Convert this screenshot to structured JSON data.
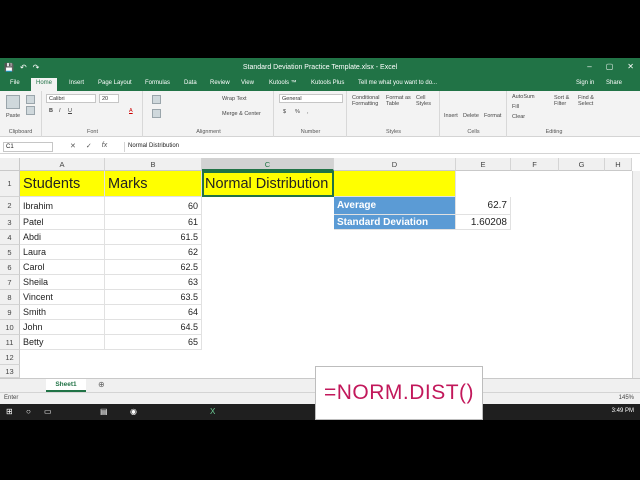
{
  "window": {
    "title": "Standard Deviation Practice Template.xlsx - Excel",
    "controls": [
      "–",
      "▢",
      "✕"
    ],
    "qat": [
      "💾",
      "↶",
      "↷"
    ]
  },
  "tabs": [
    "File",
    "Home",
    "Insert",
    "Page Layout",
    "Formulas",
    "Data",
    "Review",
    "View",
    "Kutools ™",
    "Kutools Plus"
  ],
  "tell_me": "Tell me what you want to do...",
  "sign_in": "Sign in",
  "share": "Share",
  "ribbon": {
    "clipboard": {
      "label": "Clipboard",
      "paste": "Paste"
    },
    "font": {
      "label": "Font",
      "name": "Calibri",
      "size": "20",
      "bold": "B",
      "italic": "I",
      "underline": "U",
      "color": "A"
    },
    "alignment": {
      "label": "Alignment",
      "wrap": "Wrap Text",
      "merge": "Merge & Center"
    },
    "number": {
      "label": "Number",
      "format": "General",
      "currency": "$",
      "percent": "%",
      "comma": ","
    },
    "styles": {
      "label": "Styles",
      "conditional": "Conditional Formatting",
      "format_table": "Format as Table",
      "cell_styles": "Cell Styles"
    },
    "cells": {
      "label": "Cells",
      "insert": "Insert",
      "delete": "Delete",
      "format": "Format"
    },
    "editing": {
      "label": "Editing",
      "autosum": "AutoSum",
      "fill": "Fill",
      "clear": "Clear",
      "sort": "Sort & Filter",
      "find": "Find & Select"
    }
  },
  "formula_bar": {
    "name_box": "C1",
    "cancel": "✕",
    "enter": "✓",
    "fx": "fx",
    "content": "Normal Distribution"
  },
  "columns": [
    "A",
    "B",
    "C",
    "D",
    "E",
    "F",
    "G",
    "H"
  ],
  "rows": [
    "1",
    "2",
    "3",
    "4",
    "5",
    "6",
    "7",
    "8",
    "9",
    "10",
    "11",
    "12",
    "13"
  ],
  "headers": {
    "students": "Students",
    "marks": "Marks",
    "normal": "Normal Distribution"
  },
  "students": [
    {
      "name": "Ibrahim",
      "mark": "60"
    },
    {
      "name": "Patel",
      "mark": "61"
    },
    {
      "name": "Abdi",
      "mark": "61.5"
    },
    {
      "name": "Laura",
      "mark": "62"
    },
    {
      "name": "Carol",
      "mark": "62.5"
    },
    {
      "name": "Sheila",
      "mark": "63"
    },
    {
      "name": "Vincent",
      "mark": "63.5"
    },
    {
      "name": "Smith",
      "mark": "64"
    },
    {
      "name": "John",
      "mark": "64.5"
    },
    {
      "name": "Betty",
      "mark": "65"
    }
  ],
  "stats": {
    "average_label": "Average",
    "average_value": "62.7",
    "stdev_label": "Standard Deviation",
    "stdev_value": "1.60208"
  },
  "sheet_tab": "Sheet1",
  "add_sheet": "⊕",
  "status": {
    "mode": "Enter",
    "zoom": "145%"
  },
  "clock": "3:49 PM",
  "overlay_formula": "=NORM.DIST()",
  "colors": {
    "excel_green": "#217346",
    "header_yellow": "#ffff00",
    "stat_blue": "#5b9bd5",
    "formula_pink": "#c2185b"
  }
}
